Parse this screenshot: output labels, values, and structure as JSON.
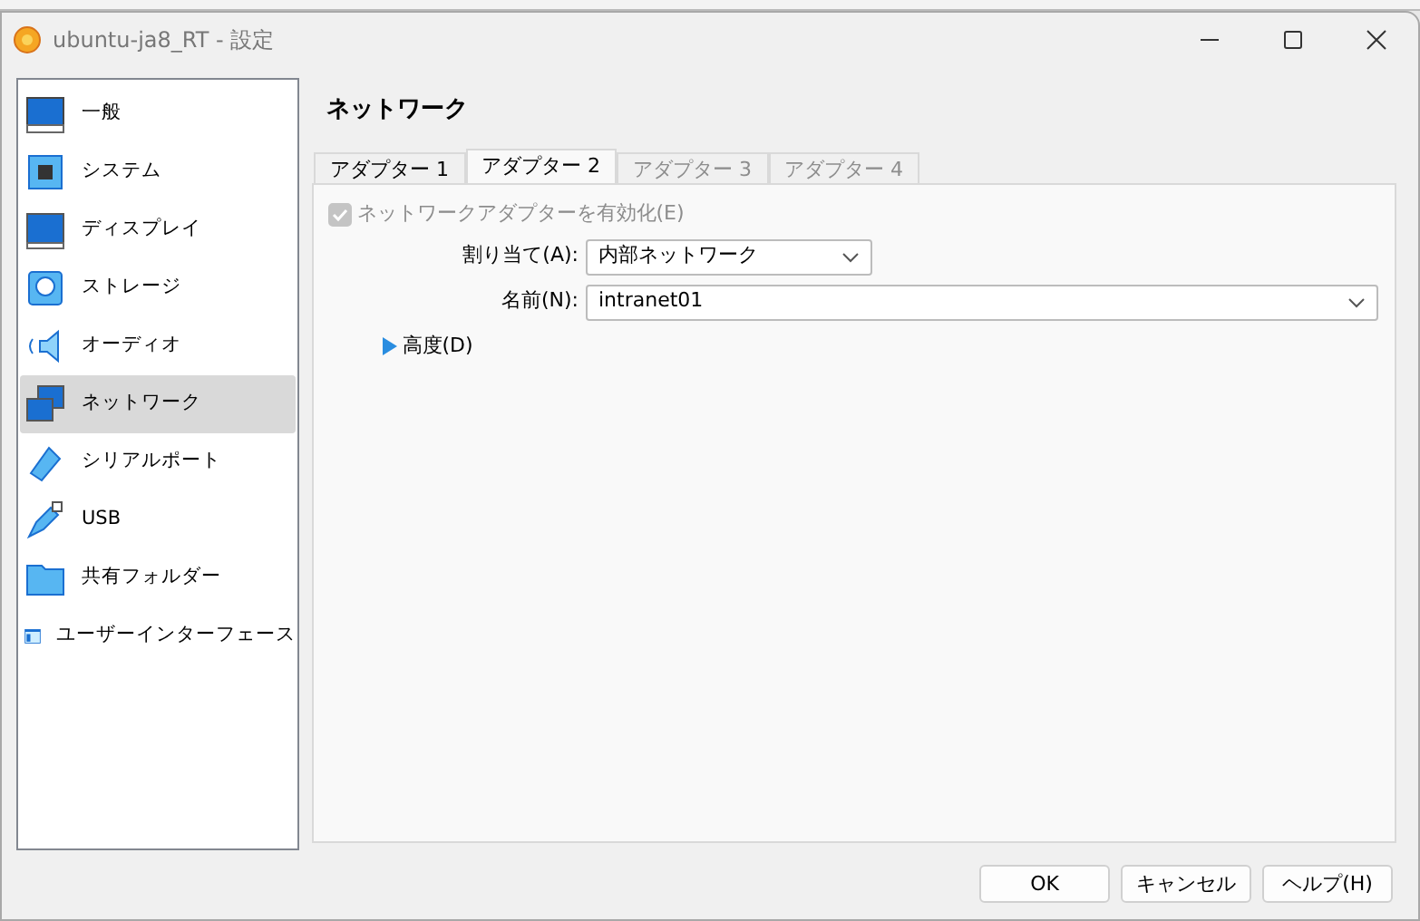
{
  "window": {
    "title": "ubuntu-ja8_RT - 設定"
  },
  "sidebar": {
    "items": [
      {
        "label": "一般",
        "selected": false
      },
      {
        "label": "システム",
        "selected": false
      },
      {
        "label": "ディスプレイ",
        "selected": false
      },
      {
        "label": "ストレージ",
        "selected": false
      },
      {
        "label": "オーディオ",
        "selected": false
      },
      {
        "label": "ネットワーク",
        "selected": true
      },
      {
        "label": "シリアルポート",
        "selected": false
      },
      {
        "label": "USB",
        "selected": false
      },
      {
        "label": "共有フォルダー",
        "selected": false
      },
      {
        "label": "ユーザーインターフェース",
        "selected": false
      }
    ]
  },
  "page_title": "ネットワーク",
  "tabs": [
    {
      "label": "アダプター 1",
      "selected": false,
      "disabled": false
    },
    {
      "label": "アダプター 2",
      "selected": true,
      "disabled": false
    },
    {
      "label": "アダプター 3",
      "selected": false,
      "disabled": true
    },
    {
      "label": "アダプター 4",
      "selected": false,
      "disabled": true
    }
  ],
  "enable_adapter": {
    "label": "ネットワークアダプターを有効化(E)",
    "checked": true,
    "disabled": true
  },
  "attached_to": {
    "label": "割り当て(A):",
    "value": "内部ネットワーク"
  },
  "name": {
    "label": "名前(N):",
    "value": "intranet01"
  },
  "advanced": {
    "label": "高度(D)",
    "expanded": false
  },
  "buttons": [
    "OK",
    "キャンセル",
    "ヘルプ(H)"
  ]
}
